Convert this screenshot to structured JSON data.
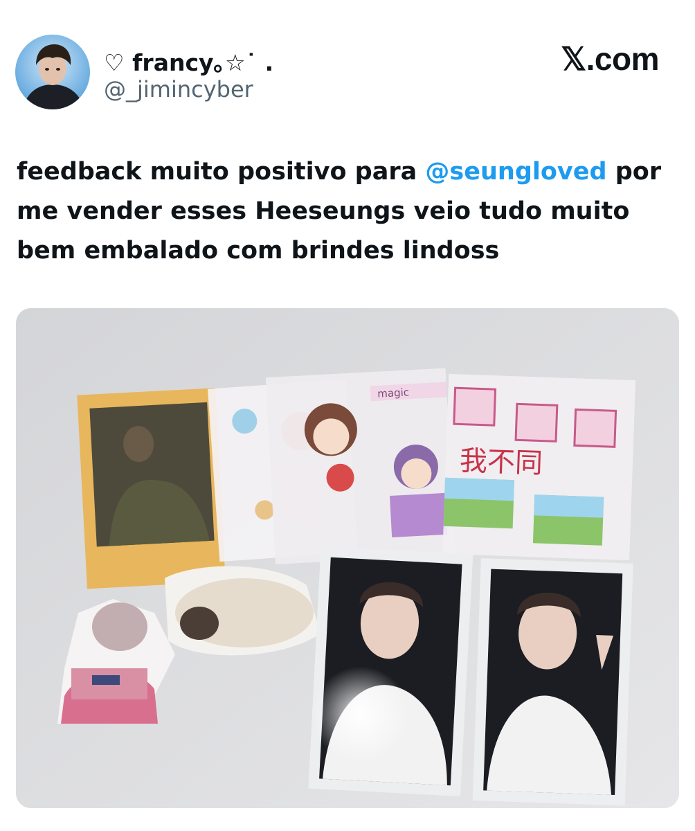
{
  "author": {
    "display_name": "♡ francy｡☆˙ .",
    "handle": "@_jimincyber",
    "avatar_icon": "user-avatar-icon"
  },
  "brand": {
    "label": "𝕏.com"
  },
  "tweet": {
    "text_before": "feedback muito positivo para ",
    "mention": "@seungloved",
    "text_after": " por me vender esses Heeseungs veio tudo muito bem embalado com brindes lindoss"
  },
  "photo": {
    "sticker_text": "我不同",
    "tape_text": "magic"
  },
  "colors": {
    "mention": "#1d9bf0",
    "text": "#0f1419",
    "muted": "#536471"
  }
}
